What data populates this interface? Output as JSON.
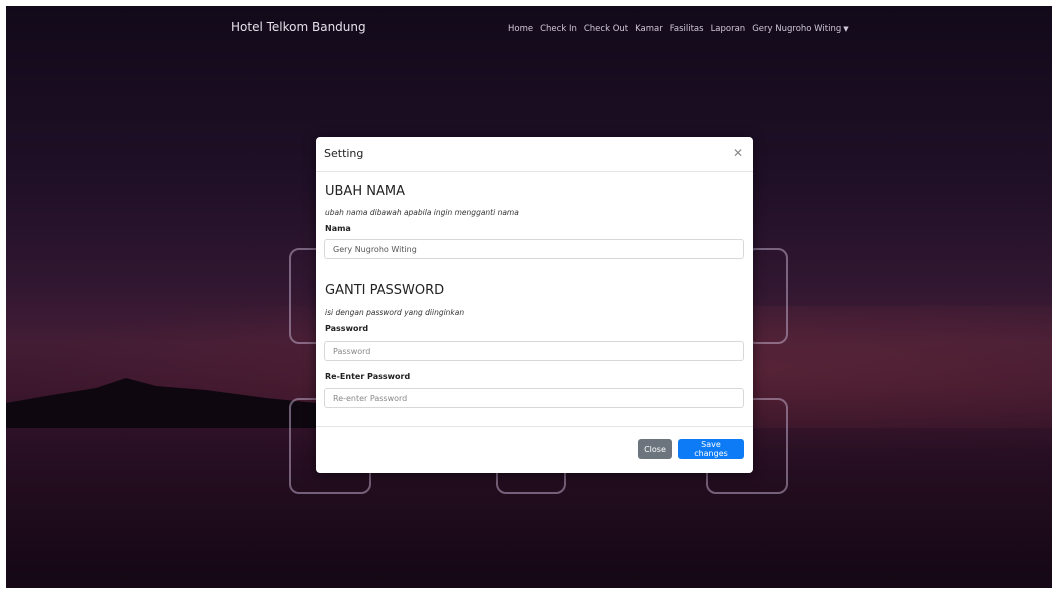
{
  "navbar": {
    "brand": "Hotel Telkom Bandung",
    "links": [
      "Home",
      "Check In",
      "Check Out",
      "Kamar",
      "Fasilitas",
      "Laporan"
    ],
    "user": "Gery Nugroho Witing"
  },
  "modal": {
    "title": "Setting",
    "rename": {
      "heading": "UBAH NAMA",
      "hint": "ubah nama dibawah apabila ingin mengganti nama",
      "label": "Nama",
      "value": "Gery Nugroho Witing"
    },
    "password": {
      "heading": "GANTI PASSWORD",
      "hint": "isi dengan password yang diinginkan",
      "label": "Password",
      "placeholder": "Password",
      "reenter_label": "Re-Enter Password",
      "reenter_placeholder": "Re-enter Password"
    },
    "footer": {
      "close_label": "Close",
      "save_label": "Save changes"
    }
  },
  "icons": [
    "close-icon",
    "caret-down-icon"
  ]
}
